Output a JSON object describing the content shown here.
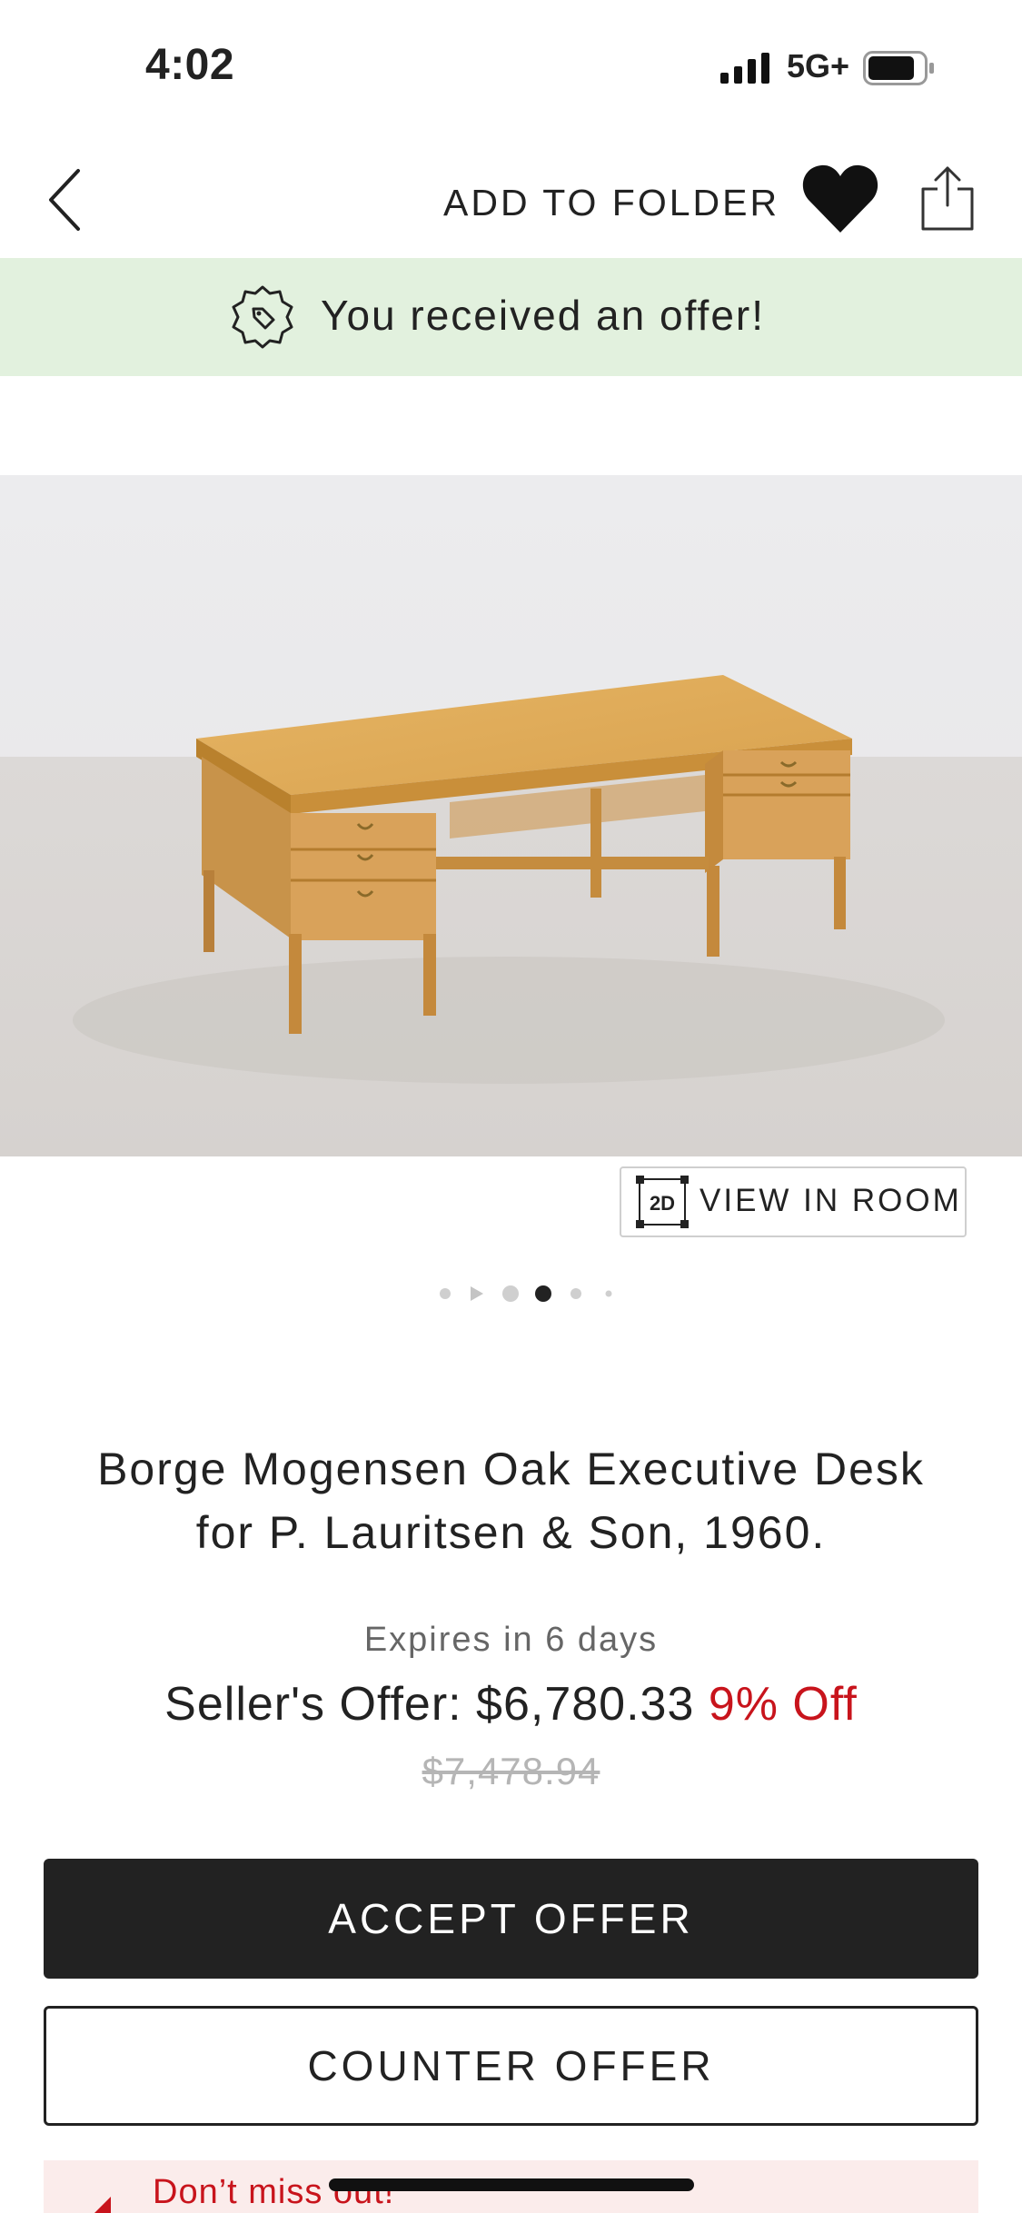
{
  "status_bar": {
    "time": "4:02",
    "network": "5G+"
  },
  "header": {
    "add_to_folder": "ADD TO FOLDER"
  },
  "offer_banner": {
    "text": "You received an offer!"
  },
  "gallery": {
    "view_in_room_badge": "2D",
    "view_in_room_label": "VIEW IN ROOM",
    "page_count": 6,
    "active_page_index": 3
  },
  "product": {
    "title_line1": "Borge Mogensen Oak Executive Desk",
    "title_line2": "for P. Lauritsen & Son, 1960.",
    "expires": "Expires in 6 days",
    "offer_prefix": "Seller's Offer: $6,780.33",
    "discount": "9% Off",
    "original_price": "$7,478.94"
  },
  "actions": {
    "accept": "ACCEPT OFFER",
    "counter": "COUNTER OFFER"
  },
  "promo": {
    "text": "Don’t miss out!"
  },
  "colors": {
    "banner_bg": "#e2f1de",
    "discount_red": "#c8141c",
    "primary_dark": "#222222"
  }
}
